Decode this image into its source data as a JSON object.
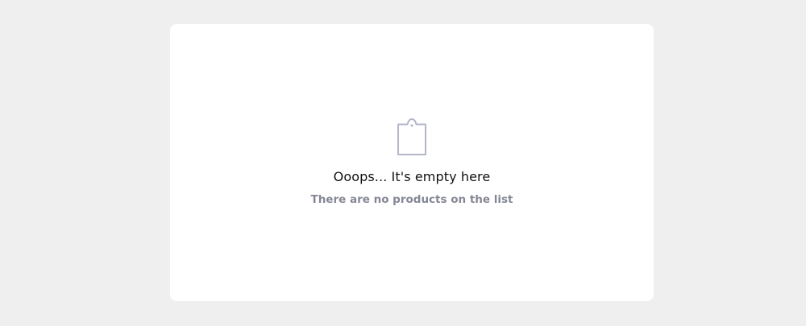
{
  "empty_state": {
    "icon": "shopping-bag-icon",
    "title": "Ooops... It's empty here",
    "subtitle": "There are no products on the list"
  },
  "colors": {
    "page_background": "#efefef",
    "card_background": "#ffffff",
    "icon_stroke": "#b3b6c7",
    "title_text": "#111111",
    "subtitle_text": "#858796"
  }
}
